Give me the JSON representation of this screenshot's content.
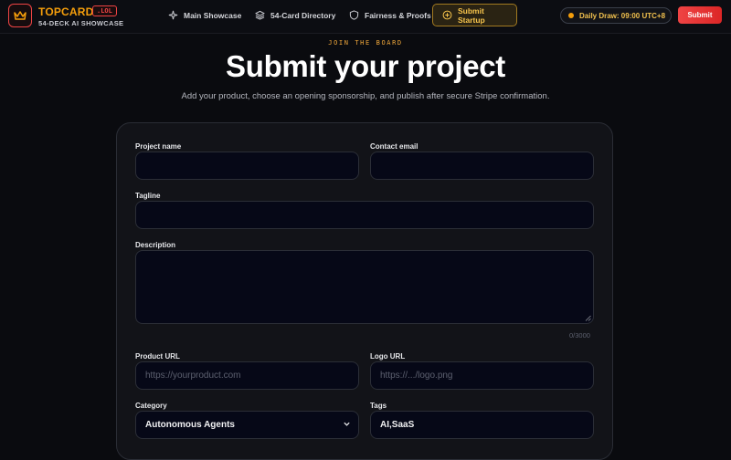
{
  "brand": {
    "name": "TOPCARD",
    "tld": ".LOL",
    "tagline": "54-DECK AI SHOWCASE",
    "logo_icon": "crown-icon"
  },
  "nav": {
    "items": [
      {
        "label": "Main Showcase",
        "icon": "sparkle-icon"
      },
      {
        "label": "54-Card Directory",
        "icon": "layers-icon"
      },
      {
        "label": "Fairness & Proofs",
        "icon": "shield-icon"
      },
      {
        "label": "Submit Startup",
        "icon": "plus-circle-icon",
        "active": true
      }
    ],
    "daily_draw": "Daily Draw: 09:00 UTC+8",
    "submit_label": "Submit"
  },
  "hero": {
    "eyebrow": "JOIN THE BOARD",
    "title": "Submit your project",
    "subtitle": "Add your product, choose an opening sponsorship, and publish after secure Stripe confirmation."
  },
  "form": {
    "project_name": {
      "label": "Project name",
      "value": ""
    },
    "contact_email": {
      "label": "Contact email",
      "value": ""
    },
    "tagline": {
      "label": "Tagline",
      "value": ""
    },
    "description": {
      "label": "Description",
      "value": "",
      "counter": "0/3000"
    },
    "product_url": {
      "label": "Product URL",
      "placeholder": "https://yourproduct.com"
    },
    "logo_url": {
      "label": "Logo URL",
      "placeholder": "https://.../logo.png"
    },
    "category": {
      "label": "Category",
      "value": "Autonomous Agents"
    },
    "tags": {
      "label": "Tags",
      "value": "AI,SaaS"
    }
  },
  "colors": {
    "background": "#0a0b0f",
    "accent_gold": "#f59e0b",
    "accent_red": "#ef4444",
    "field_bg": "#060817"
  }
}
